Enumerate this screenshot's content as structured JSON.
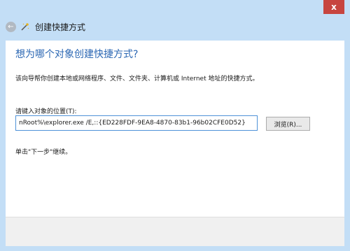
{
  "window": {
    "title": "创建快捷方式",
    "close_glyph": "x"
  },
  "icons": {
    "back": "back-arrow-icon",
    "wizard": "shortcut-wizard-icon"
  },
  "content": {
    "heading": "想为哪个对象创建快捷方式?",
    "description": "该向导帮你创建本地或网络程序、文件、文件夹、计算机或 Internet 地址的快捷方式。",
    "field_label": "请键入对象的位置(T):",
    "location_value": "nRoot%\\explorer.exe /E,::{ED228FDF-9EA8-4870-83b1-96b02CFE0D52}",
    "browse_label": "浏览(R)...",
    "hint": "单击\"下一步\"继续。"
  },
  "colors": {
    "frame": "#c3def6",
    "heading": "#2b67b3",
    "close_button": "#c7453f",
    "input_border": "#4f92d8"
  }
}
